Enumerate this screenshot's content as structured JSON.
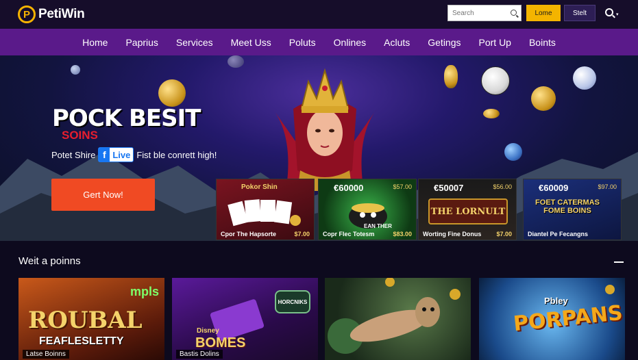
{
  "brand": {
    "logo_mark": "P",
    "name": "PetiWin"
  },
  "header": {
    "search_placeholder": "Search",
    "login_label": "Lome",
    "start_label": "Stelt",
    "caret": "▾"
  },
  "nav": {
    "items": [
      "Home",
      "Paprius",
      "Services",
      "Meet Uss",
      "Poluts",
      "Onlines",
      "Acluts",
      "Getings",
      "Port Up",
      "Boints"
    ]
  },
  "hero": {
    "title": "POCK BESIT",
    "subtitle": "SOINS",
    "line_left": "Potet Shire",
    "live_f": "f",
    "live_text": "Live",
    "line_right": "Fist ble conrett high!",
    "cta_label": "Gert Now!"
  },
  "promos": [
    {
      "amount": "",
      "small": "",
      "caption": "Cpor The Hapsorte",
      "price": "$7.00",
      "art_title": "Pokor Shin"
    },
    {
      "amount": "€60000",
      "small": "$57.00",
      "caption": "Copr Flec Totesm",
      "price": "$83.00",
      "art_title": "EAN THER"
    },
    {
      "amount": "€50007",
      "small": "$56.00",
      "caption": "Worting Fine Donus",
      "price": "$7.00",
      "art_title": "THE LORNULT"
    },
    {
      "amount": "€60009",
      "small": "$97.00",
      "caption": "Diantel Pe Fecangns",
      "price": "",
      "art_title": "FOET CATERMAS FOME BOINS"
    }
  ],
  "section": {
    "title": "Weit a poinns",
    "collapse": "—"
  },
  "games": [
    {
      "caption": "Latse Boinns",
      "title": "ROUBAL",
      "subtitle": "FEAFLESLETTY",
      "badge": "mpls"
    },
    {
      "caption": "Bastis Dolins",
      "title": "BOMES",
      "subtitle": "Disney",
      "badge": "HORCNIKS"
    },
    {
      "caption": "",
      "title": "",
      "subtitle": "",
      "badge": ""
    },
    {
      "caption": "",
      "title": "PORPANS",
      "subtitle": "Pbley",
      "badge": ""
    }
  ]
}
